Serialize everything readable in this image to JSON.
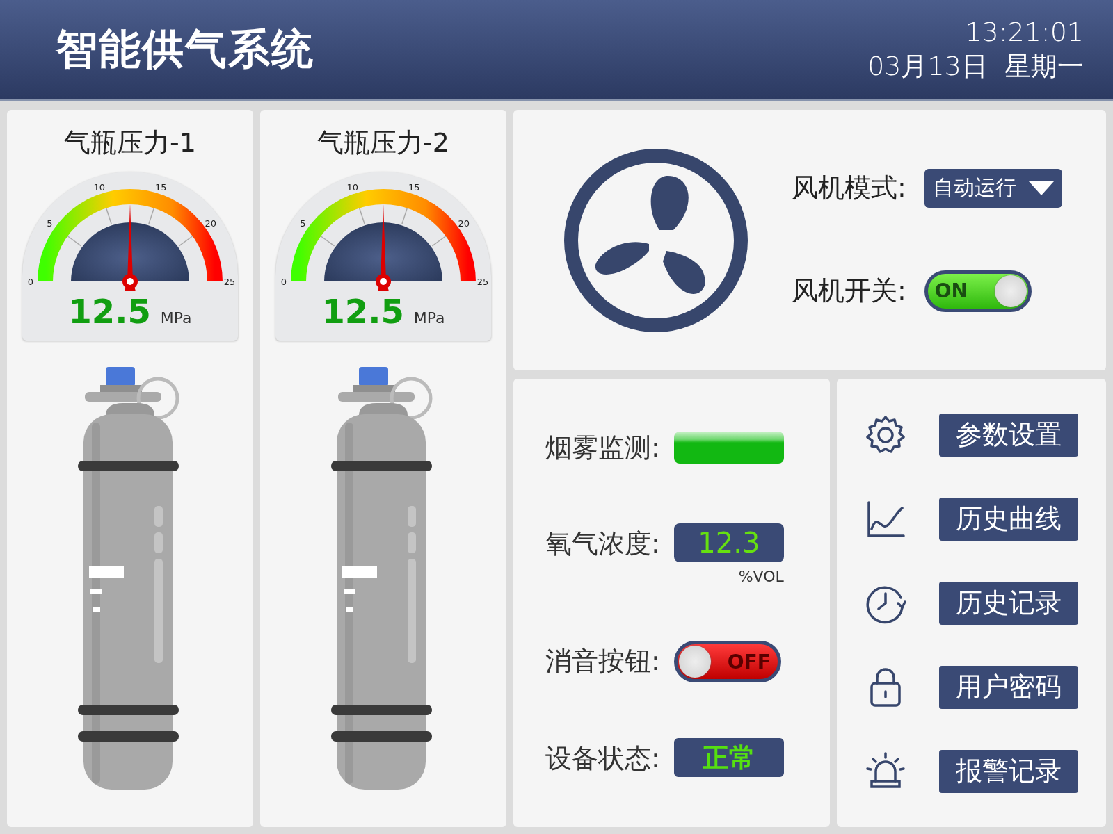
{
  "header": {
    "title": "智能供气系统",
    "time": "13:21:01",
    "date": "03月13日  星期一"
  },
  "gauges": [
    {
      "title": "气瓶压力-1",
      "ticks": [
        "0",
        "5",
        "10",
        "15",
        "20",
        "25"
      ],
      "level": 0.5,
      "value": "12.5",
      "unit": "MPa"
    },
    {
      "title": "气瓶压力-2",
      "ticks": [
        "0",
        "5",
        "10",
        "15",
        "20",
        "25"
      ],
      "level": 0.5,
      "value": "12.5",
      "unit": "MPa"
    }
  ],
  "fan": {
    "mode_label": "风机模式:",
    "mode_value": "自动运行",
    "switch_label": "风机开关:",
    "switch_on": true,
    "switch_text": "ON"
  },
  "monitors": [
    {
      "kind": "lamp",
      "label": "烟雾监测:",
      "on": true
    },
    {
      "kind": "reading",
      "label": "氧气浓度:",
      "value": "12.3",
      "unit": "%VOL"
    },
    {
      "kind": "toggle",
      "label": "消音按钮:",
      "on": false,
      "text": "OFF"
    },
    {
      "kind": "status",
      "label": "设备状态:",
      "value": "正常"
    }
  ],
  "menu": [
    {
      "kind": "gear",
      "label": "参数设置"
    },
    {
      "kind": "chart",
      "label": "历史曲线"
    },
    {
      "kind": "clock",
      "label": "历史记录"
    },
    {
      "kind": "lock",
      "label": "用户密码"
    },
    {
      "kind": "alarm",
      "label": "报警记录"
    }
  ]
}
